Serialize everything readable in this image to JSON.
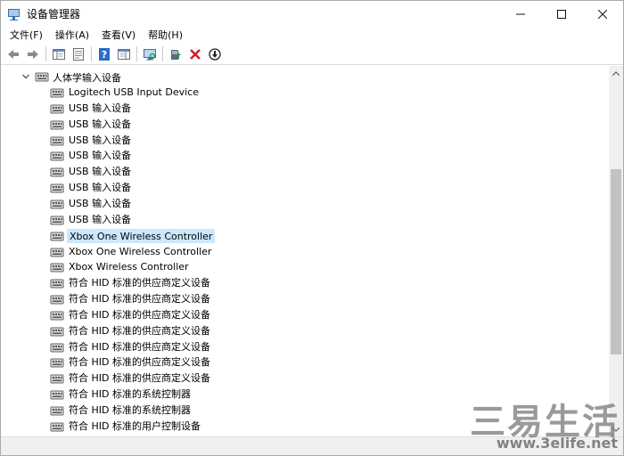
{
  "window": {
    "title": "设备管理器",
    "controls": {
      "minimize": "—",
      "maximize": "☐",
      "close": "✕"
    }
  },
  "menu": [
    "文件(F)",
    "操作(A)",
    "查看(V)",
    "帮助(H)"
  ],
  "toolbar": {
    "icons": [
      "back-arrow-icon",
      "forward-arrow-icon",
      "show-hide-tree-icon",
      "properties-icon",
      "help-icon",
      "show-hide-action-pane-icon",
      "scan-hardware-icon",
      "update-driver-icon",
      "uninstall-device-icon",
      "disable-device-icon"
    ]
  },
  "tree": {
    "category": {
      "label": "人体学输入设备",
      "expanded": true,
      "icon": "hid-device-icon"
    },
    "devices": [
      {
        "label": "Logitech USB Input Device"
      },
      {
        "label": "USB 输入设备"
      },
      {
        "label": "USB 输入设备"
      },
      {
        "label": "USB 输入设备"
      },
      {
        "label": "USB 输入设备"
      },
      {
        "label": "USB 输入设备"
      },
      {
        "label": "USB 输入设备"
      },
      {
        "label": "USB 输入设备"
      },
      {
        "label": "USB 输入设备"
      },
      {
        "label": "Xbox One Wireless Controller",
        "selected": true
      },
      {
        "label": "Xbox One Wireless Controller"
      },
      {
        "label": "Xbox Wireless Controller"
      },
      {
        "label": "符合 HID 标准的供应商定义设备"
      },
      {
        "label": "符合 HID 标准的供应商定义设备"
      },
      {
        "label": "符合 HID 标准的供应商定义设备"
      },
      {
        "label": "符合 HID 标准的供应商定义设备"
      },
      {
        "label": "符合 HID 标准的供应商定义设备"
      },
      {
        "label": "符合 HID 标准的供应商定义设备"
      },
      {
        "label": "符合 HID 标准的供应商定义设备"
      },
      {
        "label": "符合 HID 标准的系统控制器"
      },
      {
        "label": "符合 HID 标准的系统控制器"
      },
      {
        "label": "符合 HID 标准的用户控制设备"
      }
    ]
  },
  "watermark": {
    "brand": "三易生活",
    "url": "www.3elife.net"
  },
  "colors": {
    "selection": "#cce8ff",
    "uninstall_red": "#d4202a",
    "accent_blue": "#2b6cc4"
  }
}
